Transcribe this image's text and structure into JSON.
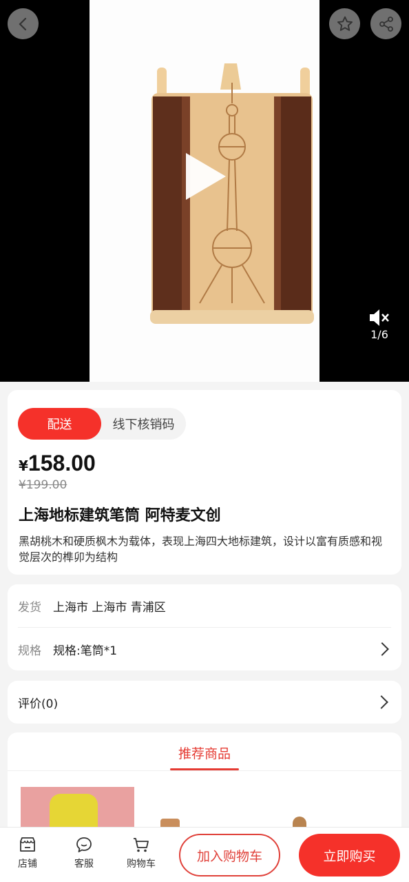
{
  "media": {
    "counter": "1/6"
  },
  "delivery_tabs": {
    "active": "配送",
    "inactive": "线下核销码"
  },
  "product": {
    "currency": "¥",
    "price": "158.00",
    "original_price": "¥199.00",
    "title": "上海地标建筑笔筒 阿特麦文创",
    "description": "黑胡桃木和硬质枫木为载体，表现上海四大地标建筑，设计以富有质感和视觉层次的榫卯为结构"
  },
  "info": {
    "ship_label": "发货",
    "ship_value": "上海市 上海市 青浦区",
    "spec_label": "规格",
    "spec_value": "规格:笔筒*1"
  },
  "reviews": {
    "label": "评价(0)"
  },
  "recommend": {
    "title": "推荐商品"
  },
  "bottom_bar": {
    "shop": "店铺",
    "service": "客服",
    "cart": "购物车",
    "add_to_cart": "加入购物车",
    "buy_now": "立即购买"
  },
  "colors": {
    "accent": "#f5312a",
    "accent_text": "#e53b33"
  }
}
